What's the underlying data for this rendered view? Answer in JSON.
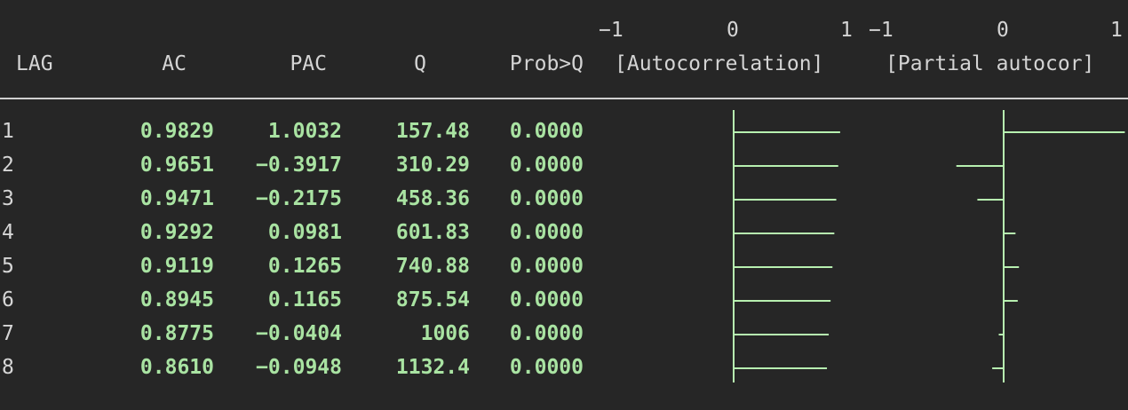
{
  "scale": {
    "ac_ticks": [
      "−1",
      "0",
      "1"
    ],
    "pac_ticks": [
      "−1",
      "0",
      "1"
    ]
  },
  "headers": {
    "lag": "LAG",
    "ac": "AC",
    "pac": "PAC",
    "q": "Q",
    "prob": "Prob>Q",
    "ac_plot": "[Autocorrelation]",
    "pac_plot": "[Partial autocor]"
  },
  "rows": [
    {
      "lag": "1",
      "ac": "0.9829",
      "pac": "1.0032",
      "q": "157.48",
      "prob": "0.0000"
    },
    {
      "lag": "2",
      "ac": "0.9651",
      "pac": "−0.3917",
      "q": "310.29",
      "prob": "0.0000"
    },
    {
      "lag": "3",
      "ac": "0.9471",
      "pac": "−0.2175",
      "q": "458.36",
      "prob": "0.0000"
    },
    {
      "lag": "4",
      "ac": "0.9292",
      "pac": "0.0981",
      "q": "601.83",
      "prob": "0.0000"
    },
    {
      "lag": "5",
      "ac": "0.9119",
      "pac": "0.1265",
      "q": "740.88",
      "prob": "0.0000"
    },
    {
      "lag": "6",
      "ac": "0.8945",
      "pac": "0.1165",
      "q": "875.54",
      "prob": "0.0000"
    },
    {
      "lag": "7",
      "ac": "0.8775",
      "pac": "−0.0404",
      "q": "1006",
      "prob": "0.0000"
    },
    {
      "lag": "8",
      "ac": "0.8610",
      "pac": "−0.0948",
      "q": "1132.4",
      "prob": "0.0000"
    }
  ],
  "chart_data": [
    {
      "type": "bar",
      "orientation": "horizontal",
      "categories": [
        "1",
        "2",
        "3",
        "4",
        "5",
        "6",
        "7",
        "8"
      ],
      "values": [
        0.9829,
        0.9651,
        0.9471,
        0.9292,
        0.9119,
        0.8945,
        0.8775,
        0.861
      ],
      "xlim": [
        -1,
        1
      ],
      "title": "[Autocorrelation]"
    },
    {
      "type": "bar",
      "orientation": "horizontal",
      "categories": [
        "1",
        "2",
        "3",
        "4",
        "5",
        "6",
        "7",
        "8"
      ],
      "values": [
        1.0032,
        -0.3917,
        -0.2175,
        0.0981,
        0.1265,
        0.1165,
        -0.0404,
        -0.0948
      ],
      "xlim": [
        -1,
        1
      ],
      "title": "[Partial autocor]"
    }
  ],
  "colors": {
    "background": "#262626",
    "values": "#a9e3a2",
    "text": "#d6d6d6",
    "bars": "#b7f0b0"
  }
}
